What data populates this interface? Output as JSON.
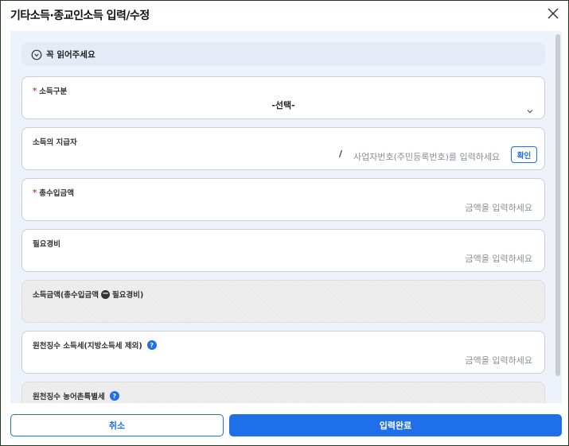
{
  "dialog": {
    "title": "기타소득·종교인소득 입력/수정",
    "close_icon": "close-icon"
  },
  "notice": {
    "icon": "chevron-down-circle-icon",
    "text": "꼭 읽어주세요"
  },
  "fields": {
    "income_type": {
      "required": "*",
      "label": "소득구분",
      "value": "-선택-"
    },
    "payer": {
      "label": "소득의 지급자",
      "slash": "/",
      "placeholder": "사업자번호(주민등록번호)를 입력하세요",
      "confirm_label": "확인"
    },
    "total_income": {
      "required": "*",
      "label": "총수입금액",
      "placeholder": "금액을 입력하세요"
    },
    "expenses": {
      "label": "필요경비",
      "placeholder": "금액을 입력하세요"
    },
    "income_amount": {
      "label_prefix": "소득금액(총수입금액",
      "minus": "−",
      "label_suffix": "필요경비)"
    },
    "withholding_tax": {
      "label": "원천징수 소득세(지방소득세 제외)",
      "help": "?",
      "placeholder": "금액을 입력하세요"
    },
    "rural_tax": {
      "label": "원천징수 농어촌특별세",
      "help": "?"
    }
  },
  "footer": {
    "cancel_label": "취소",
    "submit_label": "입력완료"
  },
  "colors": {
    "accent": "#1e6fe8",
    "required": "#e53935",
    "panel_bg": "#eef3fb"
  }
}
